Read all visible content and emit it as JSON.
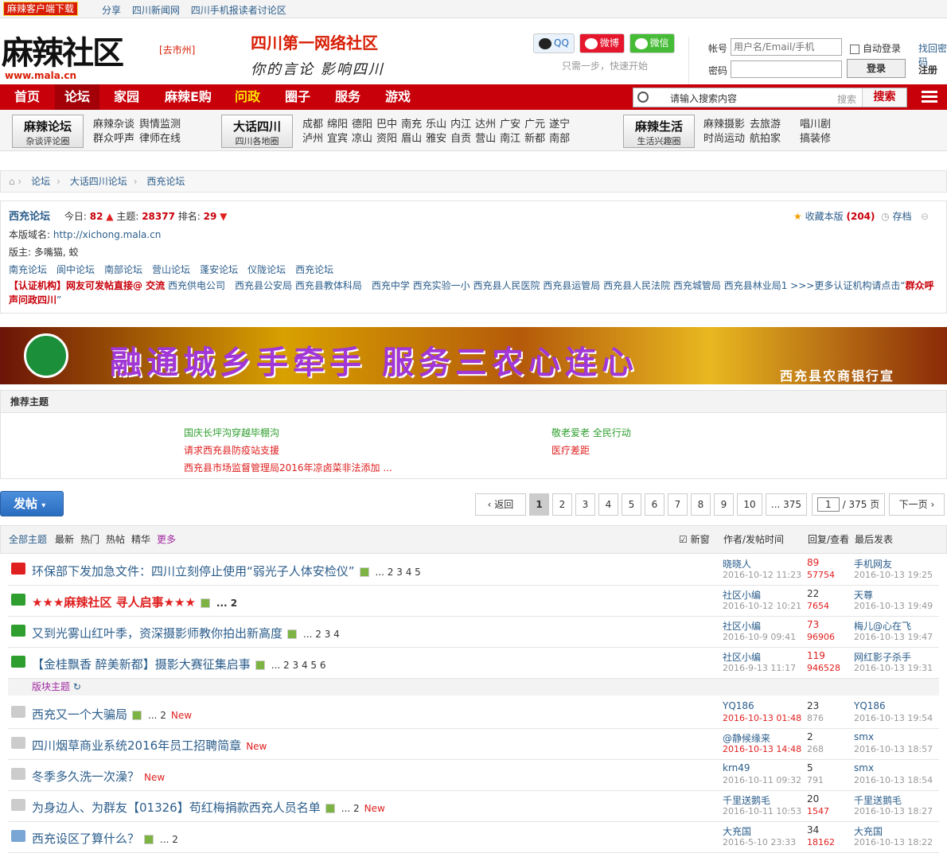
{
  "topbar": {
    "download": "麻辣客户端下载",
    "links": [
      "分享",
      "四川新闻网",
      "四川手机报读者讨论区"
    ]
  },
  "header": {
    "logo": "麻辣社区",
    "logo_url": "www.mala.cn",
    "city": "[去市州]",
    "slogan1": "四川第一网络社区",
    "slogan2": "你的言论 影响四川",
    "social": [
      "QQ",
      "微博",
      "微信"
    ],
    "social_hint": "只需一步，快速开始"
  },
  "login": {
    "user_label": "帐号",
    "user_placeholder": "用户名/Email/手机",
    "pass_label": "密码",
    "auto": "自动登录",
    "find": "找回密码",
    "login_btn": "登录",
    "register": "注册"
  },
  "nav": {
    "items": [
      "首页",
      "论坛",
      "家园",
      "麻辣E购",
      "问政",
      "圈子",
      "服务",
      "游戏"
    ],
    "search_text": "请输入搜索内容",
    "search_hint": "搜索",
    "search_btn": "搜索"
  },
  "subnav": {
    "b1": {
      "t": "麻辣论坛",
      "s": "杂谈评论圈"
    },
    "l1": [
      [
        "麻辣杂谈",
        "舆情监测"
      ],
      [
        "群众呼声",
        "律师在线"
      ]
    ],
    "b2": {
      "t": "大话四川",
      "s": "四川各地圈"
    },
    "l2": [
      [
        "成都",
        "绵阳",
        "德阳",
        "巴中",
        "南充",
        "乐山",
        "内江",
        "达州",
        "广安",
        "广元",
        "遂宁"
      ],
      [
        "泸州",
        "宜宾",
        "凉山",
        "资阳",
        "眉山",
        "雅安",
        "自贡",
        "营山",
        "南江",
        "新都",
        "南部"
      ]
    ],
    "b3": {
      "t": "麻辣生活",
      "s": "生活兴趣圈"
    },
    "l3": [
      [
        "麻辣摄影",
        "去旅游",
        "唱川剧"
      ],
      [
        "时尚运动",
        "航拍家",
        "搞装修"
      ]
    ]
  },
  "breadcrumb": [
    "论坛",
    "大话四川论坛",
    "西充论坛"
  ],
  "forum": {
    "name": "西充论坛",
    "today_label": "今日:",
    "today": "82",
    "topics_label": "主题:",
    "topics": "28377",
    "rank_label": "排名:",
    "rank": "29",
    "fav": "收藏本版",
    "fav_count": "(204)",
    "archive": "存档",
    "domain_label": "本版域名:",
    "domain": "http://xichong.mala.cn",
    "mods_label": "版主:",
    "mods": "多嘴猫, 蛟",
    "links": [
      "南充论坛",
      "阆中论坛",
      "南部论坛",
      "营山论坛",
      "蓬安论坛",
      "仪陇论坛",
      "西充论坛"
    ],
    "cert_prefix": "【认证机构】网友可发帖直接@ 交流",
    "cert_links": "西充供电公司　西充县公安局 西充县教体科局　西充中学 西充实验一小 西充县人民医院 西充县运管局 西充县人民法院 西充城管局 西充县林业局1 >>>更多认证机构请点击“",
    "cert_end": "群众呼声问政四川",
    "cert_close": "”"
  },
  "banner": {
    "text": "融通城乡手牵手 服务三农心连心",
    "bank": "西充县农商银行宣"
  },
  "recommend": {
    "title": "推荐主题",
    "items": [
      "国庆长坪沟穿越毕棚沟",
      "敬老爱老 全民行动",
      "请求西充县防疫站支援",
      "医疗差距",
      "西充县市场监督管理局2016年凉卤菜非法添加 ..."
    ]
  },
  "pager": {
    "post": "发帖",
    "back": "返回",
    "pages": [
      "1",
      "2",
      "3",
      "4",
      "5",
      "6",
      "7",
      "8",
      "9",
      "10",
      "... 375"
    ],
    "input": "1",
    "total": "/ 375 页",
    "next": "下一页"
  },
  "tabs": {
    "items": [
      "全部主题",
      "最新",
      "热门",
      "热帖",
      "精华",
      "更多"
    ],
    "newwin": "新窗",
    "author": "作者/发帖时间",
    "reply": "回复/查看",
    "last": "最后发表"
  },
  "section": "版块主题",
  "threads": [
    {
      "title": "环保部下发加急文件：四川立刻停止使用“弱光子人体安检仪”",
      "pages": "... 2 3 4 5",
      "au": "晓晓人",
      "dt": "2016-10-12 11:23",
      "rp": "89",
      "vw": "57754",
      "la": "手机网友",
      "ld": "2016-10-13 19:25"
    },
    {
      "title": "★★★麻辣社区 寻人启事★★★",
      "pages": "... 2",
      "au": "社区小编",
      "dt": "2016-10-12 10:21",
      "rp": "22",
      "vw": "7654",
      "la": "天尊",
      "ld": "2016-10-13 19:49"
    },
    {
      "title": "又到光雾山红叶季，资深摄影师教你拍出新高度",
      "pages": "... 2 3 4",
      "au": "社区小编",
      "dt": "2016-10-9 09:41",
      "rp": "73",
      "vw": "96906",
      "la": "梅儿@心在飞",
      "ld": "2016-10-13 19:47"
    },
    {
      "title": "【金桂飘香 醉美新都】摄影大赛征集启事",
      "pages": "... 2 3 4 5 6",
      "au": "社区小编",
      "dt": "2016-9-13 11:17",
      "rp": "119",
      "vw": "946528",
      "la": "网红影子杀手",
      "ld": "2016-10-13 19:31"
    },
    {
      "title": "西充又一个大骗局",
      "pages": "... 2",
      "new": "New",
      "au": "YQ186",
      "dt": "2016-10-13 01:48",
      "rp": "23",
      "vw": "876",
      "la": "YQ186",
      "ld": "2016-10-13 19:54"
    },
    {
      "title": "四川烟草商业系统2016年员工招聘简章",
      "new": "New",
      "au": "@静候缘来",
      "dt": "2016-10-13 14:48",
      "rp": "2",
      "vw": "268",
      "la": "smx",
      "ld": "2016-10-13 18:57"
    },
    {
      "title": "冬季多久洗一次澡？",
      "new": "New",
      "au": "krn49",
      "dt": "2016-10-11 09:32",
      "rp": "5",
      "vw": "791",
      "la": "smx",
      "ld": "2016-10-13 18:54"
    },
    {
      "title": "为身边人、为群友【01326】苟红梅捐款西充人员名单",
      "pages": "... 2",
      "new": "New",
      "au": "千里送鹅毛",
      "dt": "2016-10-11 10:53",
      "rp": "20",
      "vw": "1547",
      "la": "千里送鹅毛",
      "ld": "2016-10-13 18:27"
    },
    {
      "title": "西充设区了算什么？",
      "pages": "... 2",
      "au": "大充国",
      "dt": "2016-5-10 23:33",
      "rp": "34",
      "vw": "18162",
      "la": "大充国",
      "ld": "2016-10-13 18:22"
    }
  ]
}
